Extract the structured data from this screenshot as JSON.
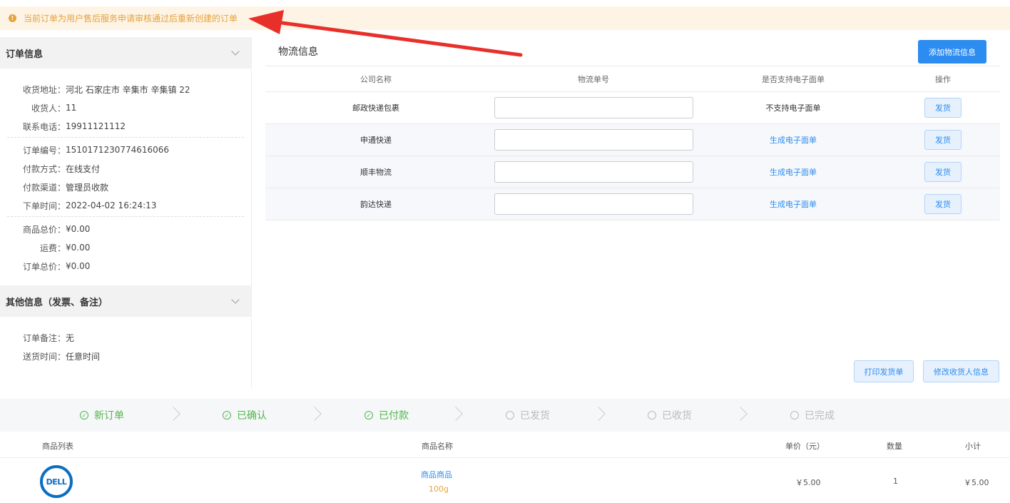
{
  "notice": {
    "text": "当前订单为用户售后服务申请审核通过后重新创建的订单"
  },
  "order_info": {
    "title": "订单信息",
    "address_label": "收货地址：",
    "address": "河北 石家庄市 辛集市 辛集镇 22",
    "receiver_label": "收货人：",
    "receiver": "11",
    "phone_label": "联系电话：",
    "phone": "19911121112",
    "order_no_label": "订单编号：",
    "order_no": "1510171230774616066",
    "pay_method_label": "付款方式：",
    "pay_method": "在线支付",
    "pay_channel_label": "付款渠道：",
    "pay_channel": "管理员收款",
    "order_time_label": "下单时间：",
    "order_time": "2022-04-02 16:24:13",
    "goods_total_label": "商品总价：",
    "goods_total": "¥0.00",
    "freight_label": "运费：",
    "freight": "¥0.00",
    "order_total_label": "订单总价：",
    "order_total": "¥0.00"
  },
  "other_info": {
    "title": "其他信息（发票、备注）",
    "remark_label": "订单备注：",
    "remark": "无",
    "delivery_time_label": "送货时间：",
    "delivery_time": "任意时间"
  },
  "logistics": {
    "title": "物流信息",
    "add_button": "添加物流信息",
    "headers": {
      "company": "公司名称",
      "tracking": "物流单号",
      "e_sheet": "是否支持电子面单",
      "action": "操作"
    },
    "rows": [
      {
        "company": "邮政快递包裹",
        "e_sheet": "不支持电子面单",
        "action": "发货"
      },
      {
        "company": "申通快递",
        "e_sheet": "生成电子面单",
        "action": "发货"
      },
      {
        "company": "顺丰物流",
        "e_sheet": "生成电子面单",
        "action": "发货"
      },
      {
        "company": "韵达快递",
        "e_sheet": "生成电子面单",
        "action": "发货"
      }
    ],
    "print_button": "打印发货单",
    "edit_receiver_button": "修改收货人信息"
  },
  "steps": [
    {
      "label": "新订单",
      "status": "done"
    },
    {
      "label": "已确认",
      "status": "done"
    },
    {
      "label": "已付款",
      "status": "done"
    },
    {
      "label": "已发货",
      "status": "todo"
    },
    {
      "label": "已收货",
      "status": "todo"
    },
    {
      "label": "已完成",
      "status": "todo"
    }
  ],
  "products": {
    "headers": {
      "list": "商品列表",
      "name": "商品名称",
      "price": "单价（元）",
      "qty": "数量",
      "subtotal": "小计"
    },
    "items": [
      {
        "logo_text": "DELL",
        "name": "商品商品",
        "spec": "100g",
        "price": "￥5.00",
        "qty": "1",
        "subtotal": "￥5.00"
      }
    ]
  },
  "colors": {
    "primary": "#2d8cf0",
    "warning": "#e6a23c",
    "success": "#52b64a",
    "arrow": "#e8302a"
  }
}
